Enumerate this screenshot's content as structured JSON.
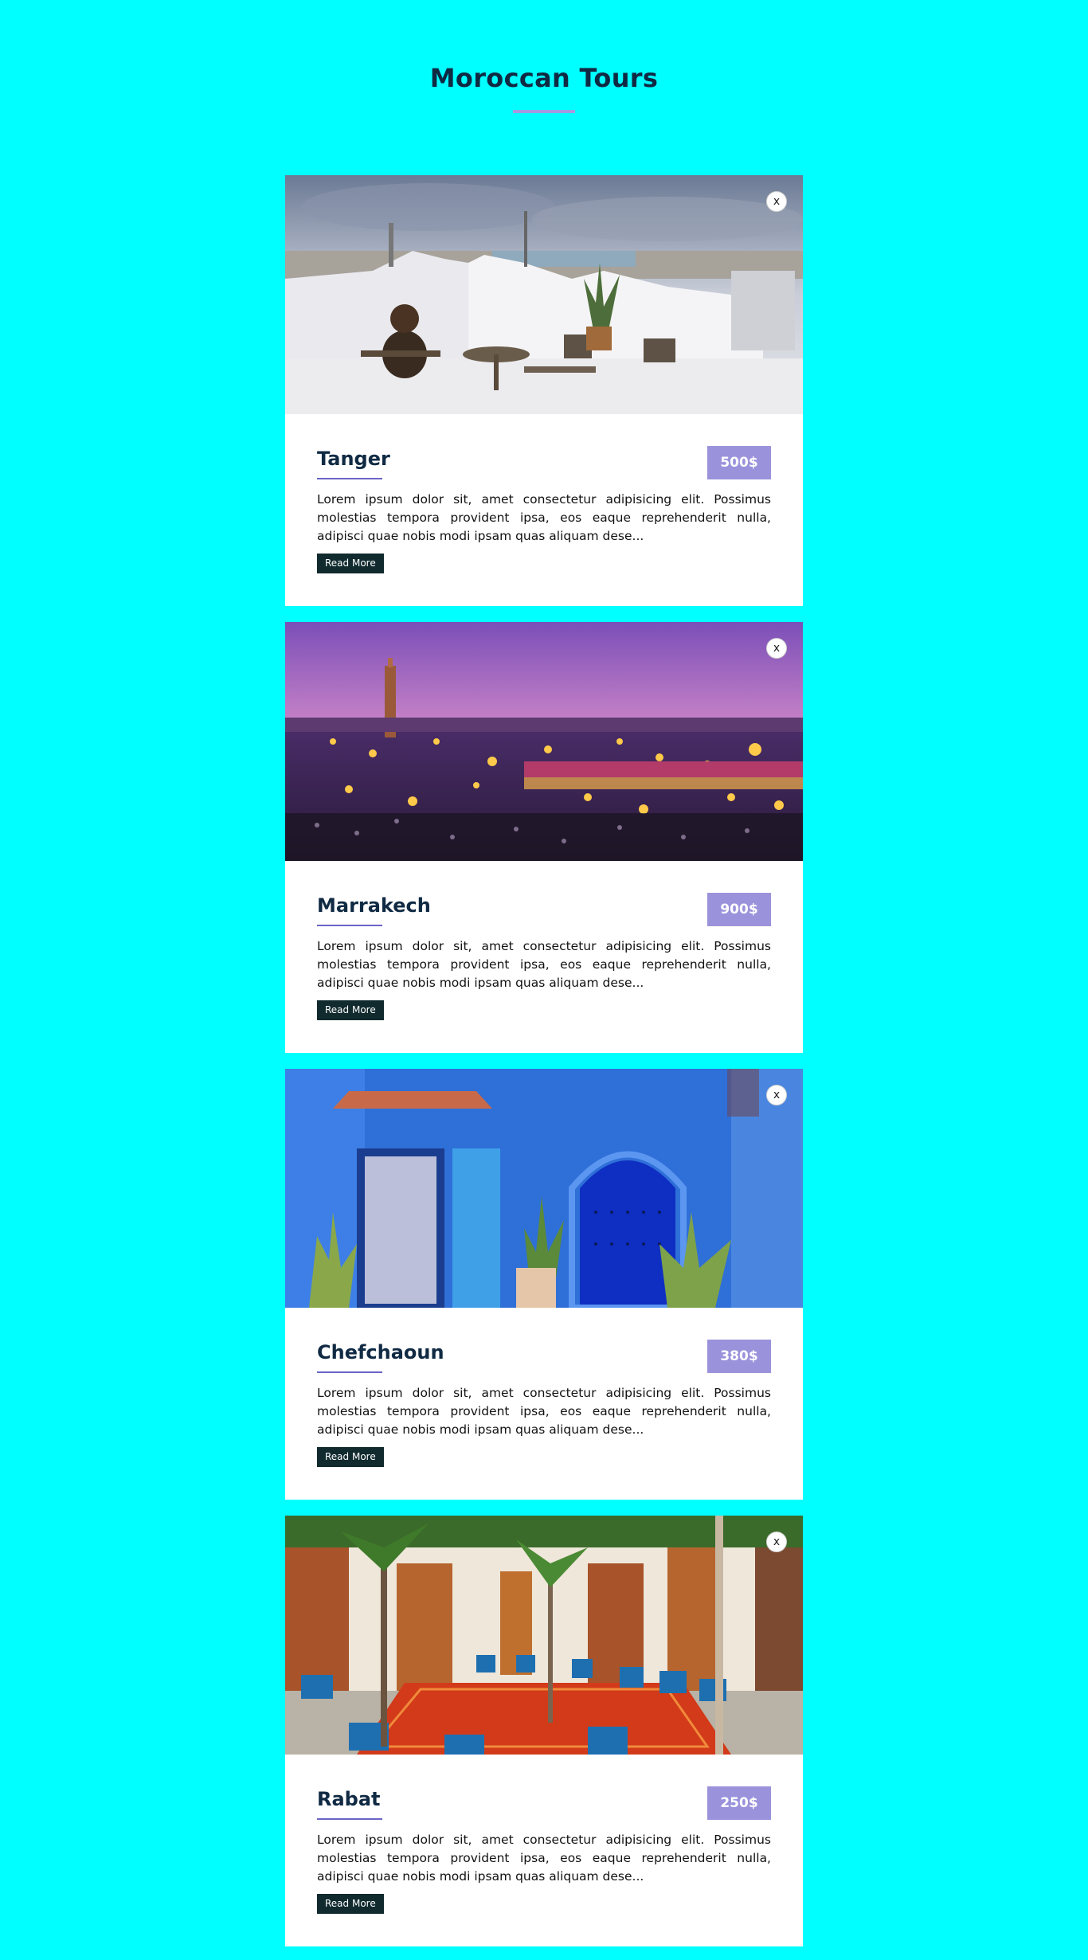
{
  "header": {
    "title": "Moroccan Tours"
  },
  "tours": [
    {
      "name": "Tanger",
      "price": "500$",
      "close_label": "x",
      "description": "Lorem ipsum dolor sit, amet consectetur adipisicing elit. Possimus molestias tempora provident ipsa, eos eaque reprehenderit nulla, adipisci quae nobis modi ipsam quas aliquam dese...",
      "read_more_label": "Read More"
    },
    {
      "name": "Marrakech",
      "price": "900$",
      "close_label": "x",
      "description": "Lorem ipsum dolor sit, amet consectetur adipisicing elit. Possimus molestias tempora provident ipsa, eos eaque reprehenderit nulla, adipisci quae nobis modi ipsam quas aliquam dese...",
      "read_more_label": "Read More"
    },
    {
      "name": "Chefchaoun",
      "price": "380$",
      "close_label": "x",
      "description": "Lorem ipsum dolor sit, amet consectetur adipisicing elit. Possimus molestias tempora provident ipsa, eos eaque reprehenderit nulla, adipisci quae nobis modi ipsam quas aliquam dese...",
      "read_more_label": "Read More"
    },
    {
      "name": "Rabat",
      "price": "250$",
      "close_label": "x",
      "description": "Lorem ipsum dolor sit, amet consectetur adipisicing elit. Possimus molestias tempora provident ipsa, eos eaque reprehenderit nulla, adipisci quae nobis modi ipsam quas aliquam dese...",
      "read_more_label": "Read More"
    }
  ],
  "colors": {
    "background": "#00ffff",
    "accent": "#9a93dc",
    "button": "#102a2e"
  }
}
